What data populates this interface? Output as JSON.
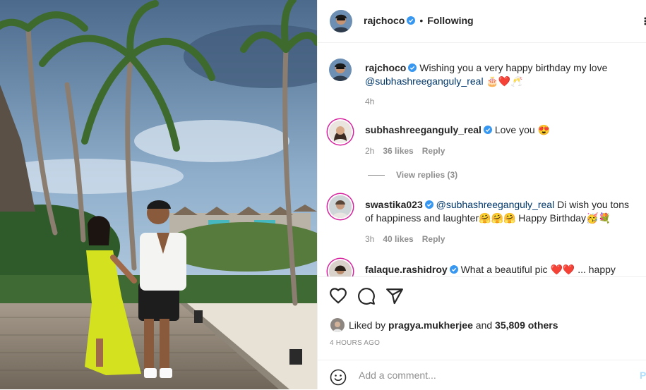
{
  "header": {
    "username": "rajchoco",
    "separator": "•",
    "follow_status": "Following"
  },
  "comments": [
    {
      "username": "rajchoco",
      "text": " Wishing you a very happy birthday my love",
      "mention": "@subhashreeganguly_real",
      "emoji": " 🎂❤️🥂",
      "time": "4h"
    },
    {
      "username": "subhashreeganguly_real",
      "text": " Love you 😍",
      "time": "2h",
      "likes": "36 likes",
      "reply": "Reply",
      "view_replies": "View replies (3)"
    },
    {
      "username": "swastika023",
      "mention": "@subhashreeganguly_real",
      "text": " Di wish you tons of happiness and laughter🤗🤗🤗 Happy Birthday🥳💐",
      "time": "3h",
      "likes": "40 likes",
      "reply": "Reply"
    },
    {
      "username": "falaque.rashidroy",
      "text": " What a beautiful pic ❤️❤️ ... happy"
    }
  ],
  "likes": {
    "prefix": "Liked by ",
    "user": "pragya.mukherjee",
    "middle": " and ",
    "count": "35,809 others"
  },
  "timestamp": "4 HOURS AGO",
  "add_comment": {
    "placeholder": "Add a comment...",
    "post_label": "P"
  },
  "colors": {
    "verified": "#3897f0",
    "mention": "#00376b",
    "muted": "#8e8e8e",
    "story_ring": "#d6249f"
  }
}
